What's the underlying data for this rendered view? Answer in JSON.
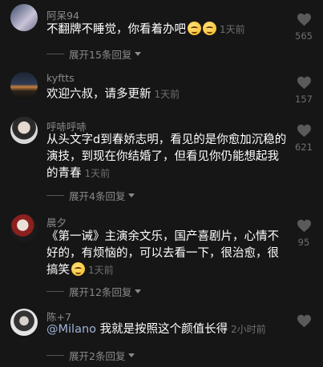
{
  "comments": [
    {
      "username": "阿呆94",
      "text": "不翻牌不睡觉，你看着办吧",
      "emojis": [
        "grinning-sweat-emoji",
        "grinning-sweat-emoji"
      ],
      "time": "1天前",
      "replies": "展开15条回复",
      "likes": "565"
    },
    {
      "username": "kyftts",
      "text": "欢迎六叔，请多更新",
      "time": "1天前",
      "likes": "157"
    },
    {
      "username": "呼哧呼哧",
      "text": "从头文字d到春娇志明，看见的是你愈加沉稳的演技，到现在你结婚了，但看见你仍能想起我的青春",
      "time": "1天前",
      "replies": "展开4条回复",
      "likes": "621"
    },
    {
      "username": "晨夕",
      "text": "《第一诫》主演余文乐，国产喜剧片，心情不好的，有烦恼的，可以去看一下，很治愈，很搞笑",
      "emojis": [
        "grinning-emoji"
      ],
      "time": "1天前",
      "replies": "展开12条回复",
      "likes": "95"
    },
    {
      "username": "陈+7",
      "mention": "@Milano",
      "text": "我就是按照这个颜值长得",
      "time": "2小时前",
      "replies": "展开2条回复",
      "likes": ""
    }
  ],
  "colors": {
    "background": "#161616",
    "username": "#8a8a8a",
    "muted": "#6f6f6f",
    "heart": "#5a5a5a"
  }
}
